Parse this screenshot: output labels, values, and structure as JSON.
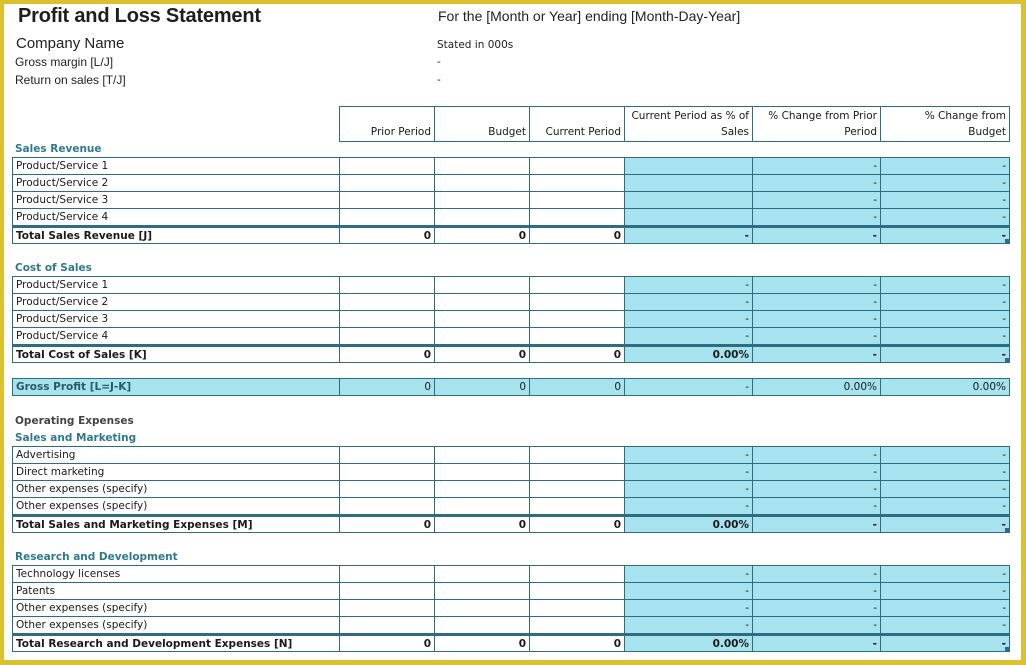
{
  "header": {
    "title": "Profit and Loss Statement",
    "company": "Company Name",
    "period": "For the [Month or Year] ending [Month-Day-Year]",
    "stated_in": "Stated in 000s",
    "gross_margin_label": "Gross margin  [L/J]",
    "gross_margin_value": "-",
    "return_on_sales_label": "Return on sales  [T/J]",
    "return_on_sales_value": "-"
  },
  "columns": [
    "Prior Period",
    "Budget",
    "Current Period",
    "Current Period as % of Sales",
    "% Change from Prior Period",
    "% Change from Budget"
  ],
  "sections": [
    {
      "id": "sales",
      "heading": "Sales Revenue",
      "rows": [
        {
          "label": "Product/Service 1",
          "values": [
            "",
            "",
            "",
            "",
            "-",
            "-"
          ]
        },
        {
          "label": "Product/Service 2",
          "values": [
            "",
            "",
            "",
            "",
            "-",
            "-"
          ]
        },
        {
          "label": "Product/Service 3",
          "values": [
            "",
            "",
            "",
            "",
            "-",
            "-"
          ]
        },
        {
          "label": "Product/Service 4",
          "values": [
            "",
            "",
            "",
            "",
            "-",
            "-"
          ]
        }
      ],
      "total": {
        "label": "Total Sales Revenue  [J]",
        "values": [
          "0",
          "0",
          "0",
          "-",
          "-",
          "-"
        ]
      }
    },
    {
      "id": "cost",
      "heading": "Cost of Sales",
      "rows": [
        {
          "label": "Product/Service 1",
          "values": [
            "",
            "",
            "",
            "-",
            "-",
            "-"
          ]
        },
        {
          "label": "Product/Service 2",
          "values": [
            "",
            "",
            "",
            "-",
            "-",
            "-"
          ]
        },
        {
          "label": "Product/Service 3",
          "values": [
            "",
            "",
            "",
            "-",
            "-",
            "-"
          ]
        },
        {
          "label": "Product/Service 4",
          "values": [
            "",
            "",
            "",
            "-",
            "-",
            "-"
          ]
        }
      ],
      "total": {
        "label": "Total Cost of Sales  [K]",
        "values": [
          "0",
          "0",
          "0",
          "0.00%",
          "-",
          "-"
        ]
      }
    },
    {
      "id": "marketing",
      "heading": "Sales and Marketing",
      "rows": [
        {
          "label": "Advertising",
          "values": [
            "",
            "",
            "",
            "-",
            "-",
            "-"
          ]
        },
        {
          "label": "Direct marketing",
          "values": [
            "",
            "",
            "",
            "-",
            "-",
            "-"
          ]
        },
        {
          "label": "Other expenses (specify)",
          "values": [
            "",
            "",
            "",
            "-",
            "-",
            "-"
          ]
        },
        {
          "label": "Other expenses (specify)",
          "values": [
            "",
            "",
            "",
            "-",
            "-",
            "-"
          ]
        }
      ],
      "total": {
        "label": "Total Sales and Marketing Expenses  [M]",
        "values": [
          "0",
          "0",
          "0",
          "0.00%",
          "-",
          "-"
        ]
      }
    },
    {
      "id": "rnd",
      "heading": "Research and Development",
      "rows": [
        {
          "label": "Technology licenses",
          "values": [
            "",
            "",
            "",
            "-",
            "-",
            "-"
          ]
        },
        {
          "label": "Patents",
          "values": [
            "",
            "",
            "",
            "-",
            "-",
            "-"
          ]
        },
        {
          "label": "Other expenses (specify)",
          "values": [
            "",
            "",
            "",
            "-",
            "-",
            "-"
          ]
        },
        {
          "label": "Other expenses (specify)",
          "values": [
            "",
            "",
            "",
            "-",
            "-",
            "-"
          ]
        }
      ],
      "total": {
        "label": "Total Research and Development Expenses  [N]",
        "values": [
          "0",
          "0",
          "0",
          "0.00%",
          "-",
          "-"
        ]
      }
    }
  ],
  "gross_profit": {
    "label": "Gross Profit  [L=J-K]",
    "values": [
      "0",
      "0",
      "0",
      "-",
      "0.00%",
      "0.00%"
    ]
  },
  "operating_expenses_label": "Operating Expenses",
  "colors": {
    "accent_fill": "#a7e3ef",
    "border": "#2e6d80",
    "heading": "#2e7a8c",
    "frame": "#dcc12e"
  }
}
